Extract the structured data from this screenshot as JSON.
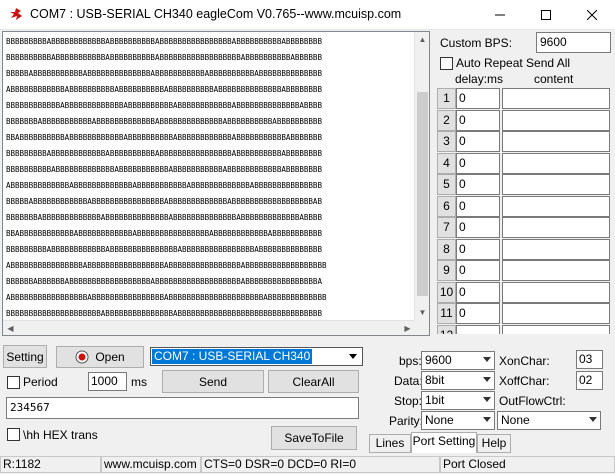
{
  "window": {
    "title": "COM7 : USB-SERIAL CH340  eagleCom V0.765--www.mcuisp.com"
  },
  "receive": {
    "lines": [
      "BBBBBBBBBABBBBBBBBBBBBABBBBBBBBBBABBBBBBBBBBBBBBBBABBBBBBBBBBABBBBBBBB",
      "BBBBBBBBBBABBBBBBBBBBBABBBBBBBBBBABBBBBBBBBBBBBBBBBBABBBBBBBBBBABBBBBB",
      "BBBBBABBBBBBBBBBBABBBBBBBBBBBBBBABBBBBBBBBBBABBBBBBBBBBABBBBBBBBBBBBBB",
      "ABBBBBBBBBBBBABBBBBBBBBBABBBBBBBBBBABBBBBBBBBBABBBBBBBBBBBBBBABBBBBBBB",
      "BBBBBBBBBBBBABBBBBBBBBBBBBABBBBBBBBBBABBBBBBBBBBBBABBBBBBBBBBBBBBABBBB",
      "BBBBBBBABBBBBBBBBBBABBBBBBBBBBBBBABBBBBBBBBBBBBBABBBBBBBBBBABBBBBBBBBB",
      "BBABBBBBBBBBBABBBBBBBBBBBBABBBBBBBBBBABBBBBBBBBBBBABBBBBBBBBBBABBBBBBB",
      "BBBBBBBBBABBBBBBBBBBBBABBBBBBBBBBABBBBBBBBBBBBBBBBABBBBBBBBBBABBBBBBBB",
      "BBBBBBBBBBABBBBBBBBBBBBBABBBBBBBBBBBABBBBBBBBBBBABBBBBBBBBBBBABBBBBBBB",
      "ABBBBBBBBBBBBBABBBBBBBBBBBBBABBBBBBBBBBBABBBBBBBBBBBBBABBBBBBBBBBBBBBB",
      "BBBBBABBBBBBBBBBBBABBBBBBBBBBBBBBBBABBBBBBBBBBBBBABBBBBBBBBBBBBBBBBBAB",
      "BBBBBBBABBBBBBBBBBBBBABBBBBBBBBBBBBBABBBBBBBBBBBBBBABBBBBBBBBBBBBABBBB",
      "BBABBBBBBBBBBBBABBBBBBBBBBBBABBBBBBBBBBBBBBBBABBBBBBBBBBBBABBBBBBBBBBB",
      "BBBBBBBBBABBBBBBBBBBBBABBBBBBBBBBBBBBBABBBBBBBBBBBBBBBBABBBBBBBBBBBBBB",
      "ABBBBBBBBBBBBBBBBABBBBBBBBBBBBBBBBBABBBBBBBBBBBBBBBBABBBBBBBBBBBBBBBBBB",
      "BBBBBBABBBBBBABBBBBBBBBBBBBBBBBBABBBBBBBBBBBBBBBBBBBABBBBBBBBBBBBBBBBA",
      "ABBBBBBBBBBBBBBBBBABBBBBBBBBBBBBBBBABBBBBBBBBBBBBBBBBBBBBABBBBBBBBBBBBB",
      "BBBBBBBBBBBBBBBBBBBBBABBBBBBBBBBBBBBBABBBBBBBBBBBBBBBBBBBBBBBBBBBBBBBB",
      "BBBBBBBBBBBBBBBBBBBBBBBBBBBBBBBBBBBBBBBBBBBBBBBBBBBBBBBBBBBAB"
    ]
  },
  "multi_send": {
    "custom_bps_label": "Custom BPS:",
    "custom_bps_value": "9600",
    "auto_repeat_label": "Auto Repeat Send All",
    "delay_header": "delay:ms",
    "content_header": "content",
    "rows": [
      {
        "num": "1",
        "delay": "0"
      },
      {
        "num": "2",
        "delay": "0"
      },
      {
        "num": "3",
        "delay": "0"
      },
      {
        "num": "4",
        "delay": "0"
      },
      {
        "num": "5",
        "delay": "0"
      },
      {
        "num": "6",
        "delay": "0"
      },
      {
        "num": "7",
        "delay": "0"
      },
      {
        "num": "8",
        "delay": "0"
      },
      {
        "num": "9",
        "delay": "0"
      },
      {
        "num": "10",
        "delay": "0"
      },
      {
        "num": "11",
        "delay": "0"
      },
      {
        "num": "12",
        "delay": ""
      }
    ]
  },
  "controls": {
    "setting_label": "Setting",
    "open_label": "Open",
    "port_value": "COM7 : USB-SERIAL CH340",
    "period_label": "Period",
    "period_value": "1000",
    "period_unit": "ms",
    "send_label": "Send",
    "clear_all_label": "ClearAll",
    "send_text": "234567",
    "hex_trans_label": "\\hh HEX trans",
    "save_to_file_label": "SaveToFile"
  },
  "port_settings": {
    "bps_label": "bps:",
    "bps_value": "9600",
    "data_label": "Data:",
    "data_value": "8bit",
    "stop_label": "Stop:",
    "stop_value": "1bit",
    "parity_label": "Parity:",
    "parity_value": "None",
    "xonchar_label": "XonChar:",
    "xonchar_value": "03",
    "xoffchar_label": "XoffChar:",
    "xoffchar_value": "02",
    "outflowctrl_label": "OutFlowCtrl:",
    "outflowctrl_value": "None"
  },
  "tabs": {
    "lines": "Lines",
    "port_setting": "Port Setting",
    "help": "Help"
  },
  "status": {
    "rx_count": "R:1182",
    "website": "www.mcuisp.com",
    "signals": "CTS=0 DSR=0 DCD=0 RI=0",
    "port_state": "Port Closed"
  },
  "colors": {
    "selection": "#0078d7",
    "button_face": "#e1e1e1",
    "icon_red": "#cc1111"
  }
}
